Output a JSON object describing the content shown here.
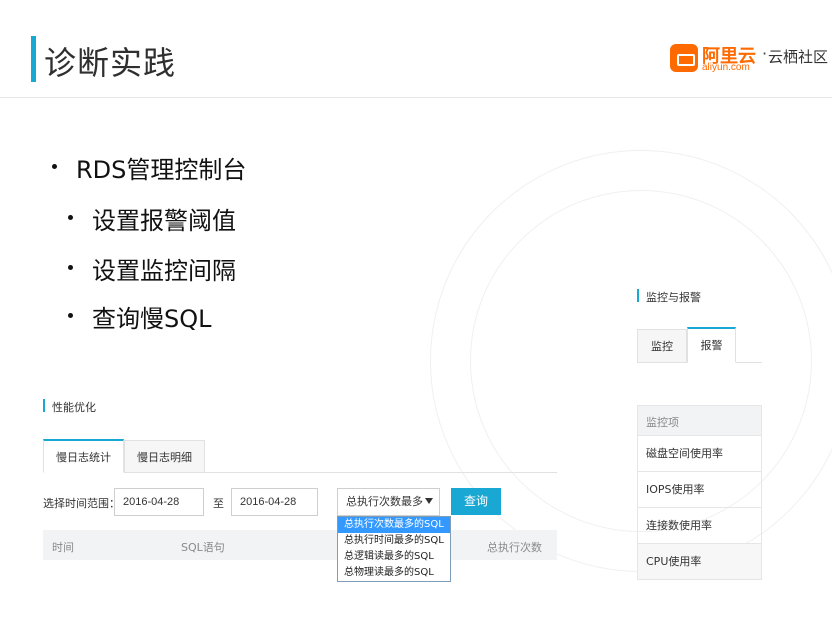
{
  "slide": {
    "title": "诊断实践",
    "logo": {
      "cn": "阿里云",
      "en": "aliyun.com",
      "sep": "·",
      "community": "云栖社区"
    }
  },
  "bullets": {
    "main": "RDS管理控制台",
    "subs": [
      "设置报警阈值",
      "设置监控间隔",
      "查询慢SQL"
    ]
  },
  "perf_panel": {
    "section_title": "性能优化",
    "tabs": [
      "慢日志统计",
      "慢日志明细"
    ],
    "time_range_label": "选择时间范围：",
    "start_date": "2016-04-28",
    "to_label": "至",
    "end_date": "2016-04-28",
    "sort_select": "总执行次数最多",
    "query_button": "查询",
    "sort_options": [
      "总执行次数最多的SQL",
      "总执行时间最多的SQL",
      "总逻辑读最多的SQL",
      "总物理读最多的SQL"
    ],
    "table_headers": [
      "时间",
      "SQL语句",
      "总执行次数"
    ]
  },
  "monitor_panel": {
    "section_title": "监控与报警",
    "tabs": [
      "监控",
      "报警"
    ],
    "list_header": "监控项",
    "items": [
      "磁盘空间使用率",
      "IOPS使用率",
      "连接数使用率",
      "CPU使用率"
    ]
  },
  "colors": {
    "accent": "#19a7d3",
    "brand": "#ff6a00"
  }
}
